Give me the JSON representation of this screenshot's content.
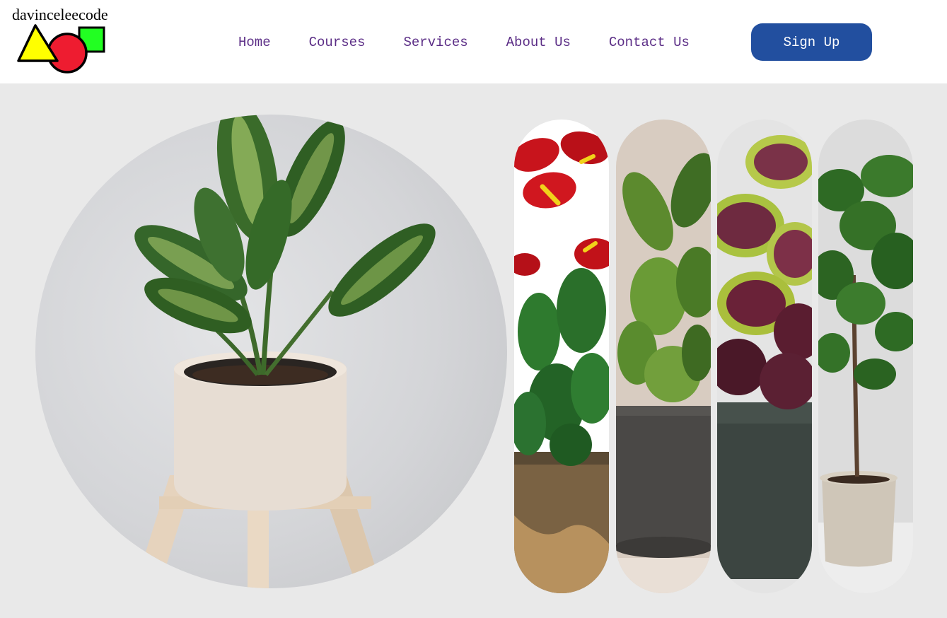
{
  "brand": {
    "name": "davinceleecode",
    "logo_icon": "shapes-logo-icon",
    "colors": {
      "triangle": "#ffff00",
      "circle": "#ee1c30",
      "square": "#22ff22"
    }
  },
  "nav": {
    "items": [
      {
        "label": "Home"
      },
      {
        "label": "Courses"
      },
      {
        "label": "Services"
      },
      {
        "label": "About Us"
      },
      {
        "label": "Contact Us"
      }
    ],
    "link_color": "#5b2d86",
    "signup_label": "Sign Up",
    "signup_color": "#224f9f"
  },
  "hero": {
    "background": "#e9e9e9",
    "main_image": "dieffenbachia-plant-in-beige-pot-on-wooden-stand",
    "gallery": [
      {
        "image": "red-anthurium-in-speckled-ceramic-pot"
      },
      {
        "image": "fiddle-leaf-fig-in-grey-pot"
      },
      {
        "image": "coleus-plant-in-dark-green-pot"
      },
      {
        "image": "fiddle-leaf-tree-in-concrete-planter"
      }
    ]
  }
}
